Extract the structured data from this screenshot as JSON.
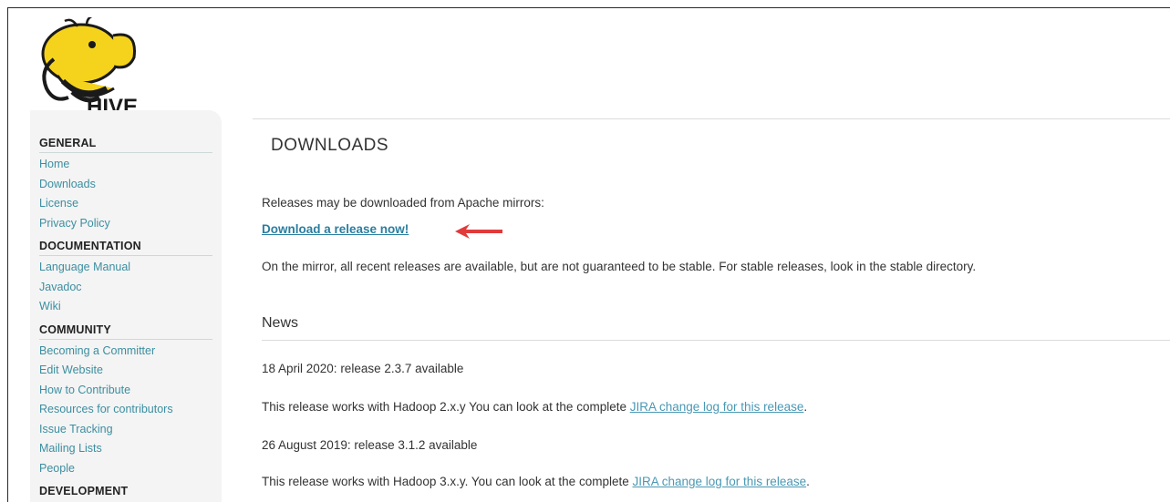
{
  "logo": {
    "text": "HIVE",
    "icon": "hive-bee-elephant-logo"
  },
  "sidebar": {
    "sections": [
      {
        "heading": "GENERAL",
        "items": [
          "Home",
          "Downloads",
          "License",
          "Privacy Policy"
        ]
      },
      {
        "heading": "DOCUMENTATION",
        "items": [
          "Language Manual",
          "Javadoc",
          "Wiki"
        ]
      },
      {
        "heading": "COMMUNITY",
        "items": [
          "Becoming a Committer",
          "Edit Website",
          "How to Contribute",
          "Resources for contributors",
          "Issue Tracking",
          "Mailing Lists",
          "People"
        ]
      },
      {
        "heading": "DEVELOPMENT",
        "items": []
      }
    ]
  },
  "main": {
    "title": "DOWNLOADS",
    "intro": "Releases may be downloaded from Apache mirrors:",
    "release_link": "Download a release now!",
    "mirror_note": "On the mirror, all recent releases are available, but are not guaranteed to be stable. For stable releases, look in the stable directory.",
    "news_title": "News",
    "news": [
      {
        "headline": "18 April 2020: release 2.3.7 available",
        "body": "This release works with Hadoop 2.x.y You can look at the complete ",
        "link": "JIRA change log for this release",
        "suffix": "."
      },
      {
        "headline": "26 August 2019: release 3.1.2 available",
        "body": "This release works with Hadoop 3.x.y. You can look at the complete ",
        "link": "JIRA change log for this release",
        "suffix": "."
      }
    ]
  },
  "colors": {
    "link": "#3c8ea0",
    "arrow": "#e03a3a",
    "logo_yellow": "#f5d31c"
  }
}
